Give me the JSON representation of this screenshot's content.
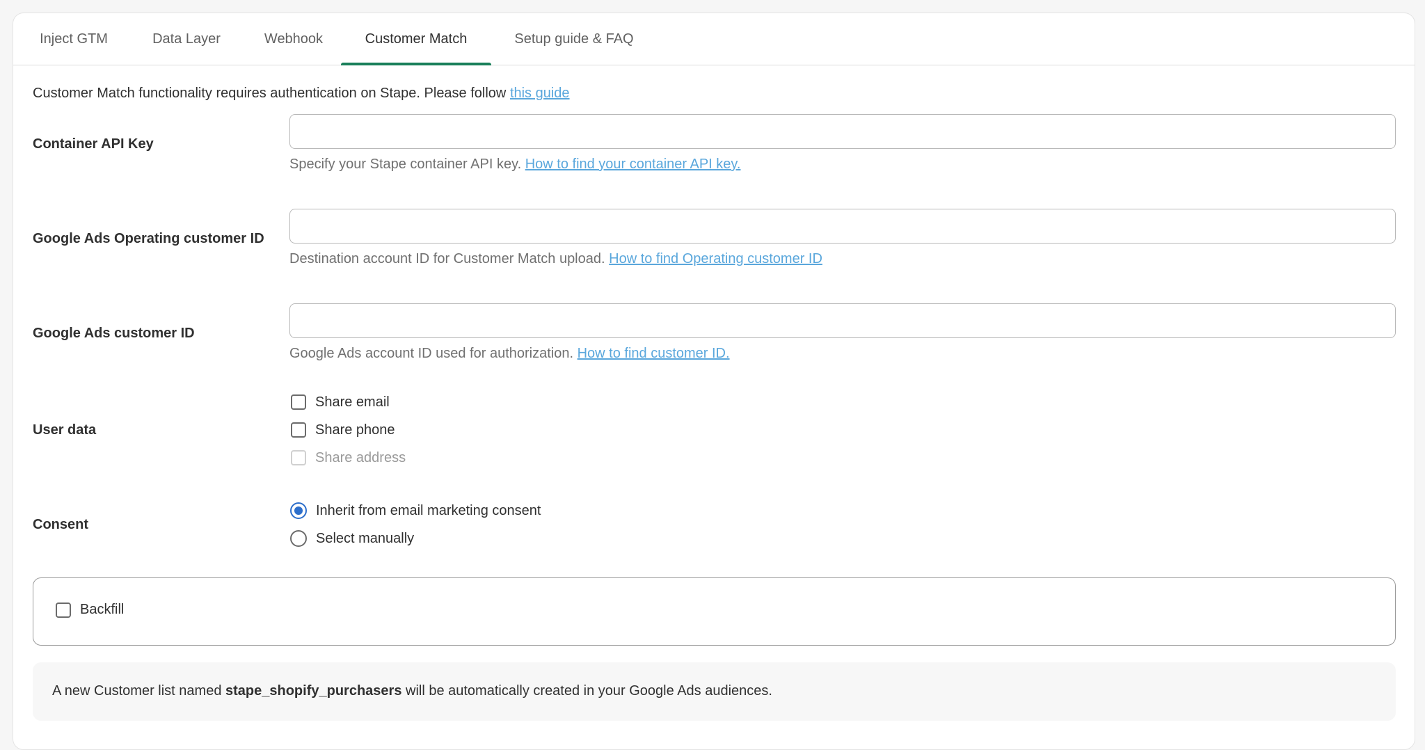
{
  "tabs": [
    {
      "label": "Inject GTM"
    },
    {
      "label": "Data Layer"
    },
    {
      "label": "Webhook"
    },
    {
      "label": "Customer Match",
      "active": true
    },
    {
      "label": "Setup guide & FAQ"
    }
  ],
  "intro": {
    "text": "Customer Match functionality requires authentication on Stape. Please follow ",
    "link": "this guide"
  },
  "fields": {
    "api_key": {
      "label": "Container API Key",
      "value": "",
      "help": "Specify your Stape container API key. ",
      "help_link": "How to find your container API key."
    },
    "operating_id": {
      "label": "Google Ads Operating customer ID",
      "value": "",
      "help": "Destination account ID for Customer Match upload. ",
      "help_link": "How to find Operating customer ID"
    },
    "customer_id": {
      "label": "Google Ads customer ID",
      "value": "",
      "help": "Google Ads account ID used for authorization. ",
      "help_link": "How to find customer ID."
    }
  },
  "user_data": {
    "label": "User data",
    "options": [
      {
        "label": "Share email",
        "checked": false,
        "disabled": false
      },
      {
        "label": "Share phone",
        "checked": false,
        "disabled": false
      },
      {
        "label": "Share address",
        "checked": false,
        "disabled": true
      }
    ]
  },
  "consent": {
    "label": "Consent",
    "options": [
      {
        "label": "Inherit from email marketing consent",
        "selected": true
      },
      {
        "label": "Select manually",
        "selected": false
      }
    ]
  },
  "backfill": {
    "label": "Backfill",
    "checked": false
  },
  "notice": {
    "before": "A new Customer list named ",
    "list_name": "stape_shopify_purchasers",
    "after": " will be automatically created in your Google Ads audiences."
  },
  "colors": {
    "active_tab_indicator": "#1a7f5a",
    "link": "#5aa7dc",
    "radio_selected": "#2c6ecb"
  }
}
